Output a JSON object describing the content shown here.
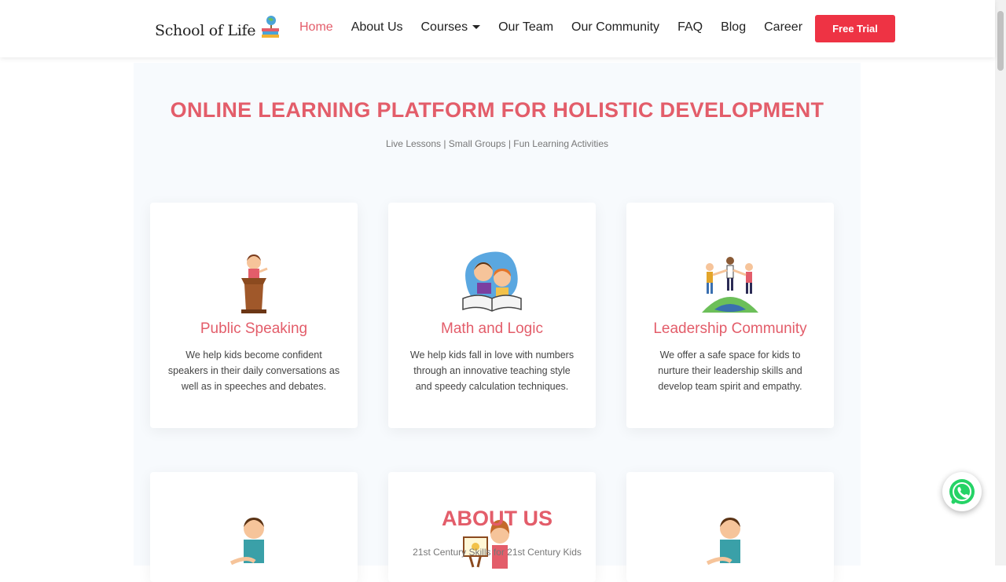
{
  "header": {
    "logo_text": "School of Life",
    "nav": [
      "Home",
      "About Us",
      "Courses",
      "Our Team",
      "Our Community",
      "FAQ",
      "Blog",
      "Career"
    ],
    "cta": "Free Trial"
  },
  "hero": {
    "title": "ONLINE LEARNING PLATFORM FOR HOLISTIC DEVELOPMENT",
    "subtitle": "Live Lessons | Small Groups | Fun Learning Activities"
  },
  "cards": [
    {
      "title": "Public Speaking",
      "text": "We help kids become confident speakers in their daily conversations as well as in speeches and debates."
    },
    {
      "title": "Math and Logic",
      "text": "We help kids fall in love with numbers through an innovative teaching style and speedy calculation techniques."
    },
    {
      "title": "Leadership Community",
      "text": "We offer a safe space for kids to nurture their leadership skills and develop team spirit and empathy."
    }
  ],
  "about": {
    "title": "ABOUT US",
    "subtitle": "21st Century Skills for 21st Century Kids"
  },
  "colors": {
    "accent": "#e35d6a",
    "cta": "#ee3344",
    "whatsapp": "#25d366"
  },
  "icons": [
    "globe-books-icon",
    "chevron-down-icon",
    "whatsapp-icon"
  ]
}
